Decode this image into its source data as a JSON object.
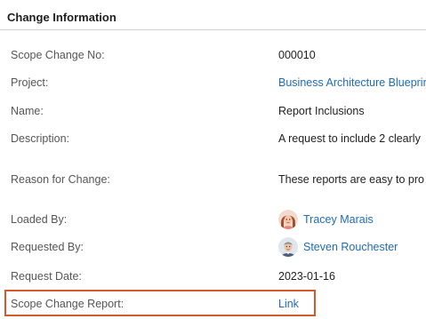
{
  "section": {
    "title": "Change Information"
  },
  "fields": {
    "scope_change_no": {
      "label": "Scope Change No:",
      "value": "000010"
    },
    "project": {
      "label": "Project:",
      "value": "Business Architecture Blueprint"
    },
    "name": {
      "label": "Name:",
      "value": "Report Inclusions"
    },
    "description": {
      "label": "Description:",
      "value": "A request to include 2 clearly"
    },
    "reason_for_change": {
      "label": "Reason for Change:",
      "value": "These reports are easy to pro"
    },
    "loaded_by": {
      "label": "Loaded By:",
      "value": "Tracey Marais",
      "avatar_icon": "female-user-avatar"
    },
    "requested_by": {
      "label": "Requested By:",
      "value": "Steven Rouchester",
      "avatar_icon": "male-user-avatar"
    },
    "request_date": {
      "label": "Request Date:",
      "value": "2023-01-16"
    },
    "scope_change_report": {
      "label": "Scope Change Report:",
      "value": "Link"
    }
  },
  "colors": {
    "link": "#1f6bb5",
    "label": "#555555",
    "highlight": "#d4592b"
  }
}
